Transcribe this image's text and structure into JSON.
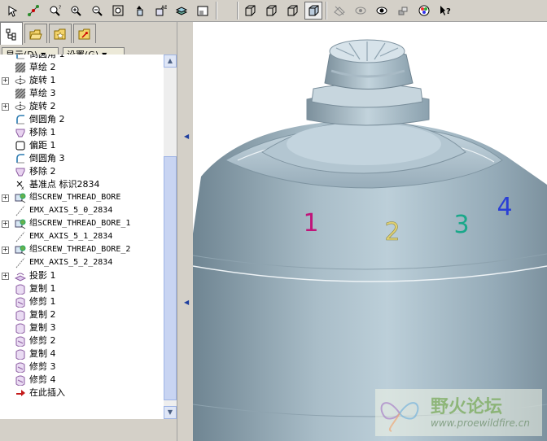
{
  "toolbar": {
    "icons": [
      "repaint-icon",
      "datum-axis-icon",
      "zoom-refit-icon",
      "zoom-in-icon",
      "zoom-out-icon",
      "zoom-window-icon",
      "orient-icon",
      "named-view-icon",
      "layers-icon",
      "view-manager-icon",
      "wireframe-icon",
      "hidden-line-icon",
      "no-hidden-icon",
      "shading-icon",
      "datum-planes-icon",
      "datum-axes-icon",
      "datum-points-icon",
      "csys-icon",
      "appearance-icon",
      "help-icon"
    ]
  },
  "left_panel": {
    "tabs": [
      "model-tree-tab",
      "folder-browser-tab",
      "favorites-tab",
      "connections-tab"
    ],
    "show_label": "显示(D)",
    "settings_label": "设置(G)",
    "tree": [
      {
        "label": "倒圆角 1",
        "icon": "round-icon",
        "expander": false,
        "mono": false
      },
      {
        "label": "草绘 2",
        "icon": "sketch-icon",
        "expander": false,
        "mono": false
      },
      {
        "label": "旋转 1",
        "icon": "revolve-icon",
        "expander": true,
        "mono": false
      },
      {
        "label": "草绘 3",
        "icon": "sketch-icon",
        "expander": false,
        "mono": false
      },
      {
        "label": "旋转 2",
        "icon": "revolve-icon",
        "expander": true,
        "mono": false
      },
      {
        "label": "倒圆角 2",
        "icon": "round-icon",
        "expander": false,
        "mono": false
      },
      {
        "label": "移除 1",
        "icon": "remove-icon",
        "expander": false,
        "mono": false
      },
      {
        "label": "偏距 1",
        "icon": "offset-icon",
        "expander": false,
        "mono": false
      },
      {
        "label": "倒圆角 3",
        "icon": "round-icon",
        "expander": false,
        "mono": false
      },
      {
        "label": "移除 2",
        "icon": "remove-icon",
        "expander": false,
        "mono": false
      },
      {
        "label": "基准点 标识2834",
        "icon": "datum-point-icon",
        "expander": false,
        "mono": false
      },
      {
        "label": "组SCREW_THREAD_BORE",
        "icon": "group-icon",
        "expander": true,
        "mono": true
      },
      {
        "label": "EMX_AXIS_5_0_2834",
        "icon": "axis-icon",
        "expander": false,
        "mono": true
      },
      {
        "label": "组SCREW_THREAD_BORE_1",
        "icon": "group-icon",
        "expander": true,
        "mono": true
      },
      {
        "label": "EMX_AXIS_5_1_2834",
        "icon": "axis-icon",
        "expander": false,
        "mono": true
      },
      {
        "label": "组SCREW_THREAD_BORE_2",
        "icon": "group-icon",
        "expander": true,
        "mono": true
      },
      {
        "label": "EMX_AXIS_5_2_2834",
        "icon": "axis-icon",
        "expander": false,
        "mono": true
      },
      {
        "label": "投影 1",
        "icon": "project-icon",
        "expander": true,
        "mono": false
      },
      {
        "label": "复制 1",
        "icon": "copy-icon",
        "expander": false,
        "mono": false
      },
      {
        "label": "修剪 1",
        "icon": "trim-icon",
        "expander": false,
        "mono": false
      },
      {
        "label": "复制 2",
        "icon": "copy-icon",
        "expander": false,
        "mono": false
      },
      {
        "label": "复制 3",
        "icon": "copy-icon",
        "expander": false,
        "mono": false
      },
      {
        "label": "修剪 2",
        "icon": "trim-icon",
        "expander": false,
        "mono": false
      },
      {
        "label": "复制 4",
        "icon": "copy-icon",
        "expander": false,
        "mono": false
      },
      {
        "label": "修剪 3",
        "icon": "trim-icon",
        "expander": false,
        "mono": false
      },
      {
        "label": "修剪 4",
        "icon": "trim-icon",
        "expander": false,
        "mono": false
      },
      {
        "label": "在此插入",
        "icon": "insert-here-icon",
        "expander": false,
        "mono": false
      }
    ]
  },
  "viewport": {
    "numbers": [
      {
        "text": "1",
        "color": "#c0147a"
      },
      {
        "text": "2",
        "color": "#e0d070"
      },
      {
        "text": "3",
        "color": "#1aa88a"
      },
      {
        "text": "4",
        "color": "#2a3fd6"
      }
    ]
  },
  "watermark": {
    "title": "野火论坛",
    "url": "www.proewildfire.cn"
  }
}
